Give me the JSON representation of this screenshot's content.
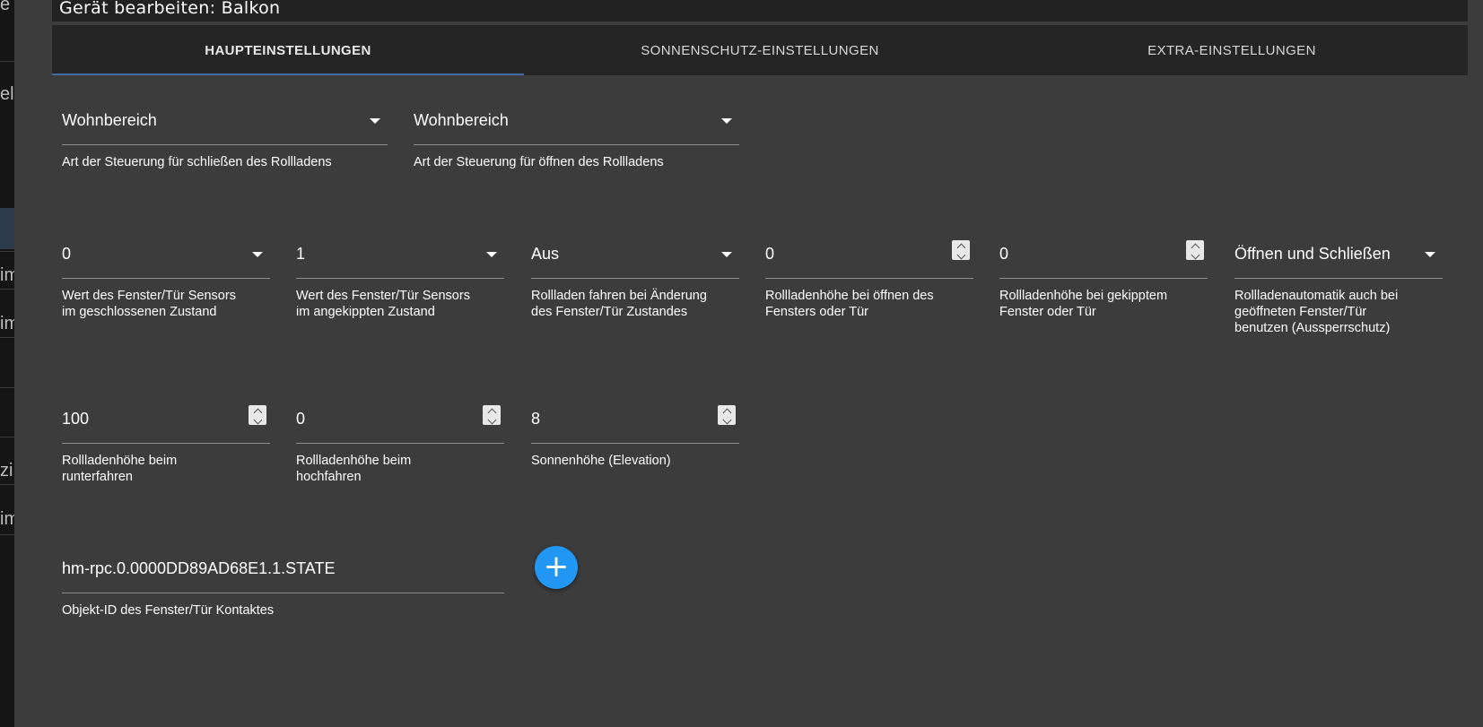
{
  "dialog": {
    "title": "Gerät bearbeiten: Balkon"
  },
  "tabs": [
    {
      "label": "HAUPTEINSTELLUNGEN",
      "active": true
    },
    {
      "label": "SONNENSCHUTZ-EINSTELLUNGEN",
      "active": false
    },
    {
      "label": "EXTRA-EINSTELLUNGEN",
      "active": false
    }
  ],
  "background_fragments": [
    "e",
    "el",
    "im",
    "im",
    "zi",
    "im"
  ],
  "colors": {
    "accent": "#2196f3",
    "panel": "#3c3c3c",
    "tab_indicator": "#3f6ea3"
  },
  "main": {
    "close_type": {
      "value": "Wohnbereich",
      "label": "Art der Steuerung für schließen des Rollladens"
    },
    "open_type": {
      "value": "Wohnbereich",
      "label": "Art der Steuerung für öffnen des Rollladens"
    },
    "sensor_closed": {
      "value": "0",
      "label_1": "Wert des Fenster/Tür Sensors",
      "label_2": "im geschlossenen Zustand"
    },
    "sensor_tilted": {
      "value": "1",
      "label_1": "Wert des Fenster/Tür Sensors",
      "label_2": "im angekippten Zustand"
    },
    "move_on_change": {
      "value": "Aus",
      "label_1": "Rollladen fahren bei Änderung",
      "label_2": "des Fenster/Tür Zustandes"
    },
    "height_open": {
      "value": "0",
      "label_1": "Rollladenhöhe bei öffnen des",
      "label_2": "Fensters oder Tür"
    },
    "height_tilted": {
      "value": "0",
      "label_1": "Rollladenhöhe bei gekipptem",
      "label_2": "Fenster oder Tür"
    },
    "lockout": {
      "value": "Öffnen und Schließen",
      "label_1": "Rollladenautomatik auch bei",
      "label_2": "geöffneten Fenster/Tür",
      "label_3": "benutzen (Aussperrschutz)"
    },
    "height_down": {
      "value": "100",
      "label_1": "Rollladenhöhe beim",
      "label_2": "runterfahren"
    },
    "height_up": {
      "value": "0",
      "label_1": "Rollladenhöhe beim",
      "label_2": "hochfahren"
    },
    "elevation": {
      "value": "8",
      "label": "Sonnenhöhe (Elevation)"
    },
    "object_id": {
      "value": "hm-rpc.0.0000DD89AD68E1.1.STATE",
      "label": "Objekt-ID des Fenster/Tür Kontaktes"
    },
    "add_button": {
      "icon": "plus-icon",
      "symbol": "+"
    }
  }
}
